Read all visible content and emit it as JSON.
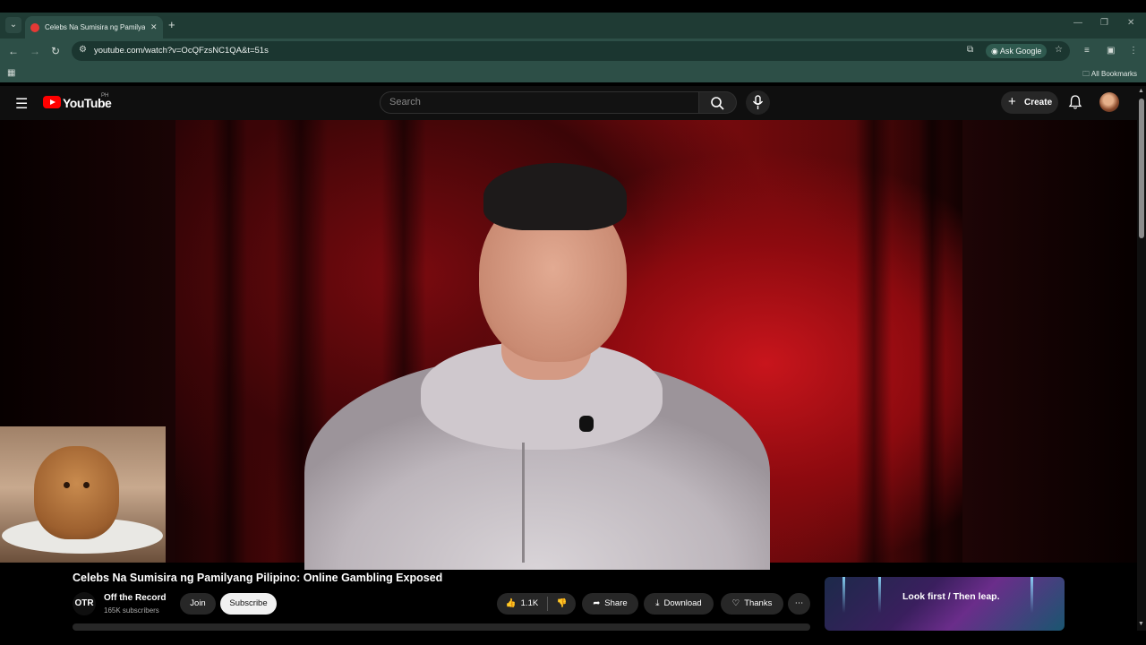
{
  "browser": {
    "tab": {
      "title": "Celebs Na Sumisira ng Pamilyang Pilipino: Online Gambling Exposed - YouTube"
    },
    "omnibox": {
      "url": "youtube.com/watch?v=OcQFzsNC1QA&t=51s"
    },
    "ask_google": "Ask Google",
    "bookmarks": {
      "all_bookmarks": "All Bookmarks"
    }
  },
  "youtube": {
    "wordmark": "YouTube",
    "country": "PH",
    "search": {
      "placeholder": "Search"
    },
    "create_label": "Create"
  },
  "video": {
    "title": "Celebs Na Sumisira ng Pamilyang Pilipino: Online Gambling Exposed",
    "channel": {
      "avatar_text": "OTR",
      "name": "Off the Record",
      "subscribers": "165K subscribers"
    },
    "join_label": "Join",
    "subscribe_label": "Subscribe",
    "like_count": "1.1K",
    "share_label": "Share",
    "download_label": "Download",
    "thanks_label": "Thanks"
  },
  "ad": {
    "text": "Look first / Then leap."
  },
  "colors": {
    "browser_chrome": "#2d4f47",
    "yt_red": "#ff0000",
    "background": "#0f0f0f"
  }
}
